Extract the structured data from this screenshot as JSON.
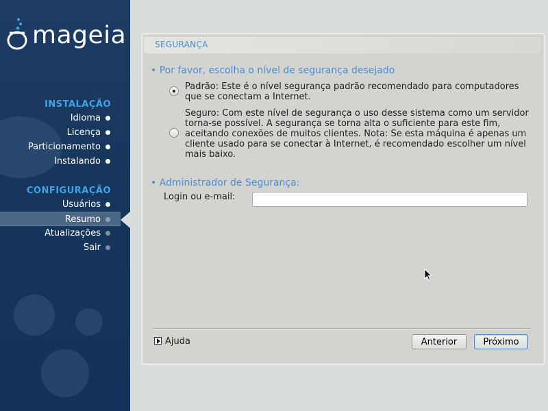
{
  "brand": {
    "logo_text": "mageia"
  },
  "sidebar": {
    "sections": [
      {
        "title": "INSTALAÇÃO",
        "items": [
          {
            "label": "Idioma",
            "state": "done"
          },
          {
            "label": "Licença",
            "state": "done"
          },
          {
            "label": "Particionamento",
            "state": "done"
          },
          {
            "label": "Instalando",
            "state": "done"
          }
        ]
      },
      {
        "title": "CONFIGURAÇÃO",
        "items": [
          {
            "label": "Usuários",
            "state": "done"
          },
          {
            "label": "Resumo",
            "state": "active"
          },
          {
            "label": "Atualizações",
            "state": "pending"
          },
          {
            "label": "Sair",
            "state": "pending"
          }
        ]
      }
    ]
  },
  "panel": {
    "title": "SEGURANÇA",
    "security_level": {
      "heading": "• Por favor, escolha o nível de segurança desejado",
      "options": [
        {
          "text": "Padrão: Este é o nível segurança padrão recomendado para computadores\nque se conectam a Internet.",
          "selected": true
        },
        {
          "text": "Seguro: Com este nível de segurança o uso desse sistema como um servidor\ntorna-se possível. A segurança se torna alta o suficiente para este fim,\naceitando conexões de muitos clientes. Nota: Se esta máquina é apenas um\ncliente usado para  se conectar à Internet, é recomendado escolher um nível\nmais baixo.",
          "selected": false
        }
      ]
    },
    "admin": {
      "heading": "• Administrador de Segurança:",
      "login_label": "Login ou e-mail:",
      "login_value": ""
    },
    "footer": {
      "help_label": "Ajuda",
      "prev_label": "Anterior",
      "next_label": "Próximo"
    }
  },
  "colors": {
    "sidebar_bg": "#1a395f",
    "accent": "#4a8fd6",
    "section_title": "#3fa3e8",
    "panel_bg": "#d3d3cf"
  }
}
